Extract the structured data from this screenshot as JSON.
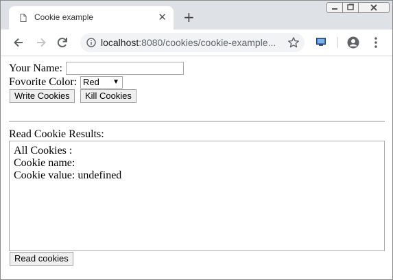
{
  "browser": {
    "tab_title": "Cookie example",
    "new_tab_symbol": "+",
    "close_symbol": "✕",
    "url_host": "localhost",
    "url_path": ":8080/cookies/cookie-example...",
    "icons": [
      "page-icon",
      "close-icon",
      "plus-icon",
      "back-icon",
      "forward-icon",
      "reload-icon",
      "info-icon",
      "star-icon",
      "extension-icon",
      "profile-icon",
      "menu-icon",
      "minimize-icon",
      "maximize-icon",
      "window-close-icon"
    ]
  },
  "form": {
    "name_label": "Your Name:",
    "name_value": "",
    "color_label": "Fovorite Color:",
    "color_selected": "Red",
    "write_button": "Write Cookies",
    "kill_button": "Kill Cookies"
  },
  "results": {
    "heading": "Read Cookie Results:",
    "lines": [
      "All Cookies :",
      "Cookie name:",
      "Cookie value: undefined"
    ],
    "read_button": "Read cookies"
  }
}
